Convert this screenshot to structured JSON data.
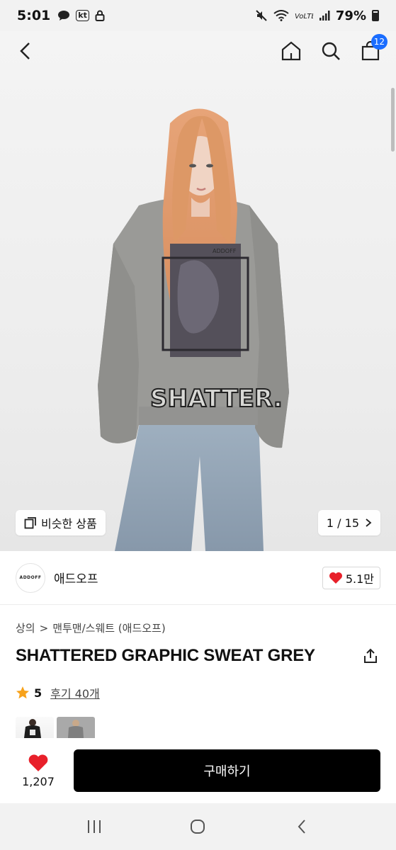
{
  "status_bar": {
    "time": "5:01",
    "carrier_badge": "kt",
    "battery_percent": "79%",
    "icons": [
      "chat-icon",
      "lock-icon",
      "mute-icon",
      "wifi-icon",
      "volte-icon",
      "signal-icon",
      "battery-icon"
    ]
  },
  "nav": {
    "cart_count": "12",
    "icons": [
      "back-icon",
      "home-icon",
      "search-icon",
      "cart-icon"
    ]
  },
  "hero": {
    "similar_label": "비슷한 상품",
    "pager": "1 / 15"
  },
  "brand": {
    "logo_text": "ADDOFF",
    "name": "애드오프",
    "likes": "5.1만"
  },
  "breadcrumb": {
    "category": "상의",
    "separator": ">",
    "subcategory": "맨투맨/스웨트 (애드오프)"
  },
  "product": {
    "title": "SHATTERED GRAPHIC SWEAT GREY",
    "rating": "5",
    "reviews": "후기 40개"
  },
  "action_bar": {
    "like_count": "1,207",
    "buy_label": "구매하기"
  },
  "colors": {
    "accent_blue": "#1a6dff",
    "heart_red": "#e8202a",
    "star": "#f7a21b",
    "buy_button": "#000000"
  }
}
